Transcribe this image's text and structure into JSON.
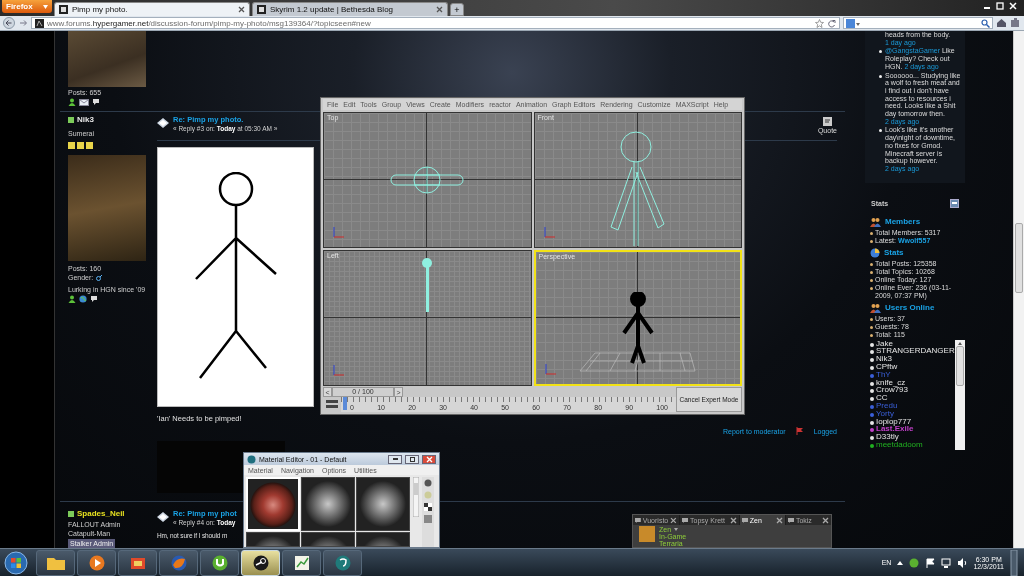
{
  "browser": {
    "menu_button": "Firefox",
    "tabs": [
      {
        "title": "Pimp my photo.",
        "selected": true
      },
      {
        "title": "Skyrim 1.2 update | Bethesda Blog",
        "selected": false
      }
    ],
    "new_tab": "+",
    "address": "www.forums.**hypergamer.net**/discussion-forum/pimp-my-photo/msg139364/?topicseen#new"
  },
  "posts": [
    {
      "kind": "partial",
      "posts": "Posts: 655"
    },
    {
      "kind": "full",
      "name": "Nik3",
      "online": true,
      "title": "Sumerai",
      "posts": "Posts: 160",
      "gender": "Gender:",
      "note": "Lurking in HGN since '09",
      "subject": "Re: Pimp my photo.",
      "reply": "« Reply #3 on: **Today** at 05:30 AM »",
      "quote": "Quote",
      "body": "'Ian' Needs to be pimped!",
      "report": "Report to moderator",
      "logged": "Logged"
    },
    {
      "kind": "cut",
      "name": "Spades_Neil",
      "online": true,
      "title": "FALLOUT Admin",
      "subtitle": "Catapult-Man",
      "badge": "Stalker Admin",
      "subject": "Re: Pimp my phot",
      "reply": "« Reply #4 on: **Today**",
      "body": "Hm, not sure if I should m"
    }
  ],
  "sidebar": {
    "shoutbox": [
      {
        "kind": "continued",
        "text": "heads from the body.",
        "time": "1 day ago"
      },
      {
        "kind": "item",
        "mention": "@GangstaGamer",
        "text": "Like Roleplay? Check out HGN.",
        "time": "2 days ago"
      },
      {
        "kind": "item",
        "text": "Soooooo... Studying like a wolf to fresh meat and i find out i don't have access to resources i need. Looks like a Shit day tomorrow then.",
        "time": "2 days ago"
      },
      {
        "kind": "item",
        "text": "Look's like it's another day\\night of downtime, no fixes for Gmod. Minecraft server is backup however.",
        "time": "2 days ago"
      }
    ],
    "stats_title": "Stats",
    "sections": [
      {
        "kind": "people",
        "heading": "Members",
        "lines": [
          {
            "text": "Total Members: 5317"
          },
          {
            "text": "Latest:",
            "link": "Wwolf557"
          }
        ]
      },
      {
        "kind": "pie",
        "heading": "Stats",
        "lines": [
          {
            "text": "Total Posts: 125358"
          },
          {
            "text": "Total Topics: 10268"
          },
          {
            "text": "Online Today: 127"
          },
          {
            "text": "Online Ever: 236 (03-11-2009, 07:37 PM)"
          }
        ]
      },
      {
        "kind": "people",
        "heading": "Users Online",
        "lines": [
          {
            "text": "Users: 37"
          },
          {
            "text": "Guests: 78"
          },
          {
            "text": "Total: 115"
          }
        ]
      }
    ],
    "online_users": [
      {
        "name": "Jake",
        "color": "#e6e6e6"
      },
      {
        "name": "STRANGERDANGER",
        "color": "#e6e6e6"
      },
      {
        "name": "Nik3",
        "color": "#e6e6e6"
      },
      {
        "name": "CPftw",
        "color": "#e6e6e6"
      },
      {
        "name": "ThY",
        "color": "#3a5fd8"
      },
      {
        "name": "knife_cz",
        "color": "#e6e6e6"
      },
      {
        "name": "Crow793",
        "color": "#e6e6e6"
      },
      {
        "name": "CC",
        "color": "#e6e6e6"
      },
      {
        "name": "Predu",
        "color": "#3a5fd8"
      },
      {
        "name": "Yorty",
        "color": "#3a5fd8"
      },
      {
        "name": "Iopiop777",
        "color": "#e6e6e6"
      },
      {
        "name": "Last.Exile",
        "color": "#c040c8"
      },
      {
        "name": "D33tly",
        "color": "#e6e6e6"
      },
      {
        "name": "meetdadoom",
        "color": "#20b020"
      }
    ]
  },
  "max_window": {
    "menu": [
      "File",
      "Edit",
      "Tools",
      "Group",
      "Views",
      "Create",
      "Modifiers",
      "reactor",
      "Animation",
      "Graph Editors",
      "Rendering",
      "Customize",
      "MAXScript",
      "Help"
    ],
    "viewports": [
      {
        "kind": "top",
        "label": "Top",
        "selected": false
      },
      {
        "kind": "front",
        "label": "Front",
        "selected": false
      },
      {
        "kind": "left",
        "label": "Left",
        "selected": false
      },
      {
        "kind": "perspective",
        "label": "Perspective",
        "selected": true
      }
    ],
    "prev": "<",
    "frame": "0 / 100",
    "next": ">",
    "level": 0,
    "ticks": [
      "0",
      "10",
      "20",
      "30",
      "40",
      "50",
      "60",
      "70",
      "80",
      "90",
      "100"
    ],
    "cancel": "Cancel Expert Mode"
  },
  "material_editor": {
    "title": "Material Editor - 01 - Default",
    "menu": [
      "Material",
      "Navigation",
      "Options",
      "Utilities"
    ],
    "slots": [
      {
        "kind": "textured",
        "selected": true
      },
      {
        "kind": "plain",
        "selected": false
      },
      {
        "kind": "plain",
        "selected": false
      },
      {
        "kind": "plain",
        "selected": false
      },
      {
        "kind": "plain",
        "selected": false
      },
      {
        "kind": "plain",
        "selected": false
      }
    ]
  },
  "chat": {
    "tabs": [
      {
        "label": "Vuoristo",
        "selected": false
      },
      {
        "label": "Topsy Krett",
        "selected": false
      },
      {
        "label": "Zen",
        "selected": true
      },
      {
        "label": "Tokiz",
        "selected": false
      }
    ],
    "friend": {
      "name": "Zen",
      "status": "In-Game",
      "game": "Terraria"
    }
  },
  "taskbar": {
    "apps": [
      {
        "kind": "folder",
        "active": false
      },
      {
        "kind": "media",
        "active": false
      },
      {
        "kind": "box",
        "active": false
      },
      {
        "kind": "browser",
        "active": false
      },
      {
        "kind": "torrent",
        "active": false
      },
      {
        "kind": "steam",
        "active": true
      },
      {
        "kind": "chart",
        "active": false
      },
      {
        "kind": "max",
        "active": false
      }
    ],
    "language": "EN",
    "time": "6:30 PM",
    "date": "12/3/2011"
  }
}
